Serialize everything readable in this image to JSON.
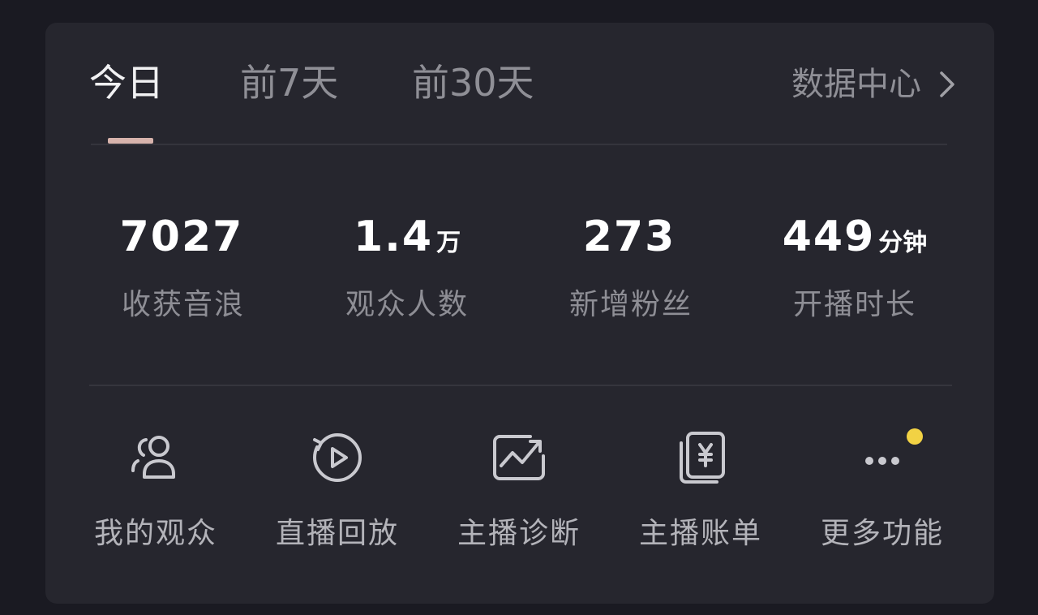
{
  "tabs": [
    {
      "label": "今日",
      "active": true
    },
    {
      "label": "前7天",
      "active": false
    },
    {
      "label": "前30天",
      "active": false
    }
  ],
  "data_center": {
    "label": "数据中心",
    "icon": "chevron-right-icon"
  },
  "stats": [
    {
      "value": "7027",
      "unit": "",
      "label": "收获音浪"
    },
    {
      "value": "1.4",
      "unit": "万",
      "label": "观众人数"
    },
    {
      "value": "273",
      "unit": "",
      "label": "新增粉丝"
    },
    {
      "value": "449",
      "unit": "分钟",
      "label": "开播时长"
    }
  ],
  "actions": [
    {
      "label": "我的观众",
      "icon": "audience-icon"
    },
    {
      "label": "直播回放",
      "icon": "replay-icon"
    },
    {
      "label": "主播诊断",
      "icon": "diagnosis-icon"
    },
    {
      "label": "主播账单",
      "icon": "bill-icon"
    },
    {
      "label": "更多功能",
      "icon": "more-icon"
    }
  ],
  "colors": {
    "page_background": "#1a1a22",
    "card_background": "#26262e",
    "tab_indicator": "#d7b3ac",
    "notification_dot": "#f2d244"
  }
}
